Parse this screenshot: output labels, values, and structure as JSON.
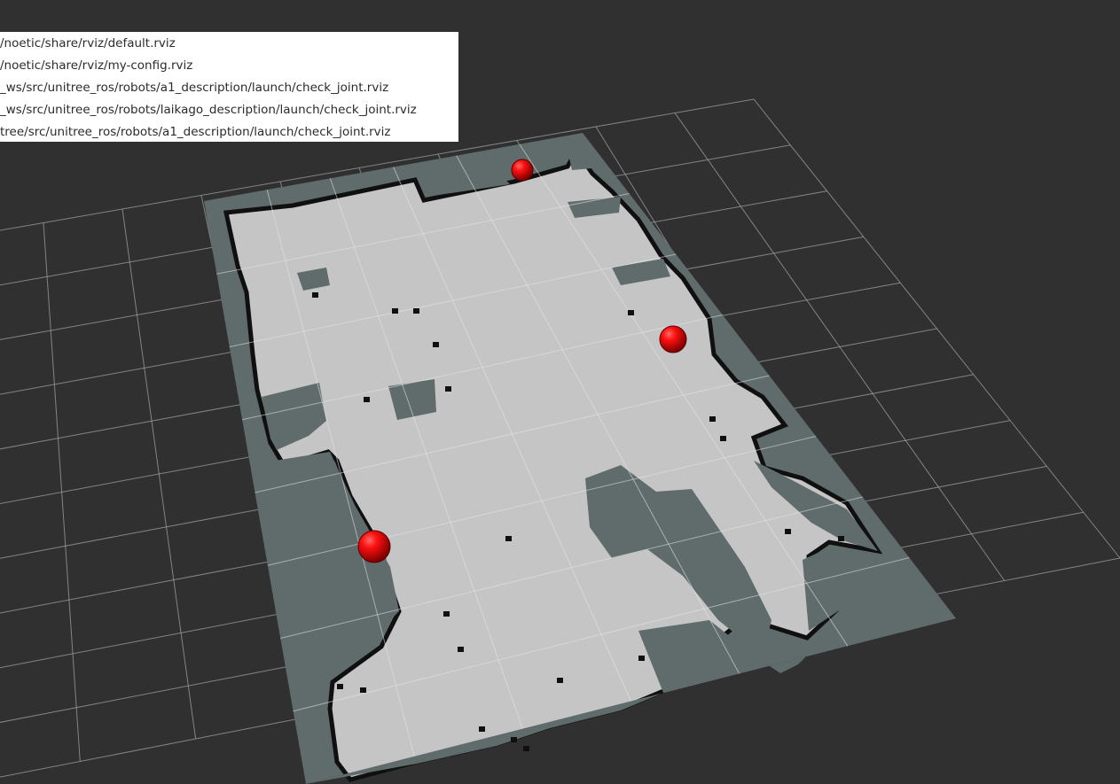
{
  "viewport": {
    "background_color": "#303030",
    "grid_color": "#a0a0a4",
    "map": {
      "unknown_color": "#5f6c6b",
      "free_color": "#c5c5c5",
      "occupied_color": "#101010"
    },
    "marker_color": "#e00000",
    "markers": [
      {
        "name": "goal-marker-top"
      },
      {
        "name": "goal-marker-right"
      },
      {
        "name": "goal-marker-left"
      }
    ]
  },
  "recent_configs": {
    "items": [
      "/noetic/share/rviz/default.rviz",
      "/noetic/share/rviz/my-config.rviz",
      "_ws/src/unitree_ros/robots/a1_description/launch/check_joint.rviz",
      "_ws/src/unitree_ros/robots/laikago_description/launch/check_joint.rviz",
      "tree/src/unitree_ros/robots/a1_description/launch/check_joint.rviz"
    ]
  }
}
